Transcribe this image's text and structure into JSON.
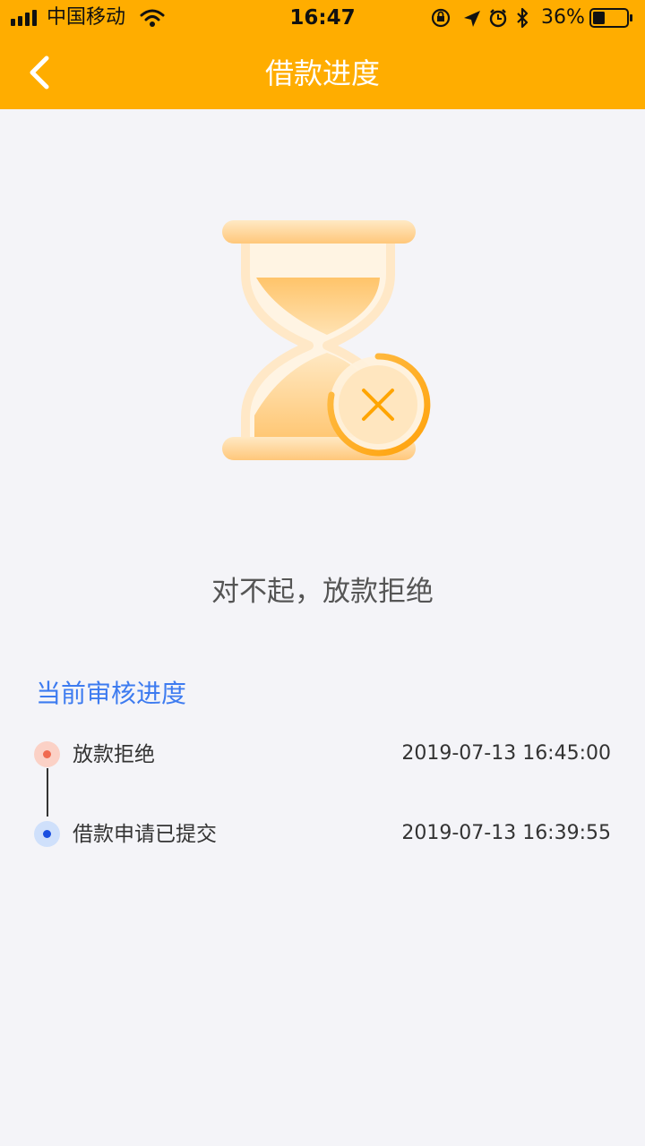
{
  "status_bar": {
    "carrier": "中国移动",
    "time": "16:47",
    "battery_percent": "36%",
    "battery_level": 0.36,
    "icons": [
      "signal-icon",
      "wifi-icon",
      "rotation-lock-icon",
      "location-icon",
      "alarm-icon",
      "bluetooth-icon",
      "battery-icon"
    ]
  },
  "nav": {
    "title": "借款进度",
    "back_icon": "chevron-left-icon"
  },
  "colors": {
    "header": "#ffad00",
    "background": "#f4f4f8",
    "accent_blue": "#3d7bf0",
    "rejected_dot": "#f06a50",
    "submitted_dot": "#1b4fe0"
  },
  "illustration": {
    "icon": "hourglass-rejected-icon"
  },
  "result": {
    "message": "对不起，放款拒绝"
  },
  "progress": {
    "title": "当前审核进度",
    "items": [
      {
        "label": "放款拒绝",
        "time": "2019-07-13 16:45:00",
        "status": "rejected"
      },
      {
        "label": "借款申请已提交",
        "time": "2019-07-13 16:39:55",
        "status": "submitted"
      }
    ]
  }
}
